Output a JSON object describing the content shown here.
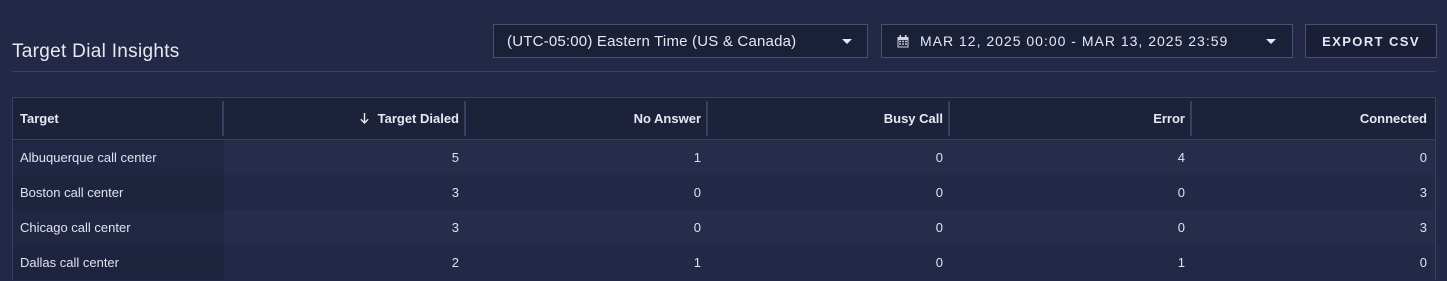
{
  "header": {
    "title": "Target Dial Insights"
  },
  "controls": {
    "timezone": "(UTC-05:00) Eastern Time (US & Canada)",
    "date_range": "MAR 12, 2025 00:00 - MAR 13, 2025 23:59",
    "export_label": "EXPORT CSV"
  },
  "table": {
    "columns": [
      "Target",
      "Target Dialed",
      "No Answer",
      "Busy Call",
      "Error",
      "Connected"
    ],
    "sorted_column": "Target Dialed",
    "sort_direction": "descending",
    "rows": [
      [
        "Albuquerque call center",
        "5",
        "1",
        "0",
        "4",
        "0"
      ],
      [
        "Boston call center",
        "3",
        "0",
        "0",
        "0",
        "3"
      ],
      [
        "Chicago call center",
        "3",
        "0",
        "0",
        "0",
        "3"
      ],
      [
        "Dallas call center",
        "2",
        "1",
        "0",
        "1",
        "0"
      ]
    ]
  },
  "colors": {
    "background": "#222845",
    "row_alt": "#262c4a",
    "header_bg": "#1d223b",
    "border": "#3a4063",
    "text": "#e6e9f2"
  },
  "icons": {
    "calendar": "calendar-icon",
    "caret": "chevron-down-icon",
    "sort": "arrow-down-icon"
  }
}
